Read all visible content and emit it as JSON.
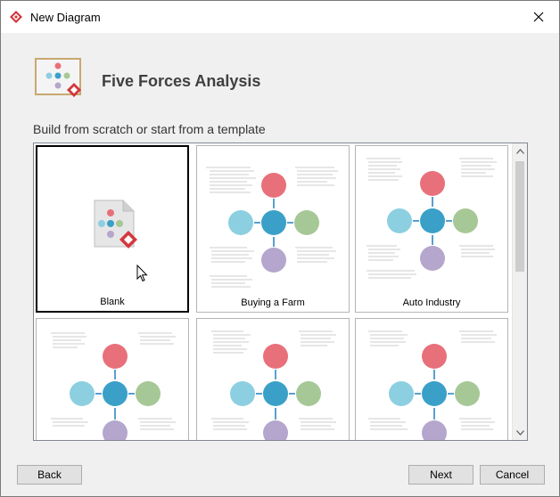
{
  "window": {
    "title": "New Diagram",
    "close_icon": "close-icon"
  },
  "header": {
    "title": "Five Forces Analysis",
    "icon": "five-forces-diagram-icon"
  },
  "subtitle": "Build from scratch or start from a template",
  "templates": [
    {
      "label": "Blank",
      "selected": true
    },
    {
      "label": "Buying a Farm",
      "selected": false
    },
    {
      "label": "Auto Industry",
      "selected": false
    },
    {
      "label": "",
      "selected": false
    },
    {
      "label": "",
      "selected": false
    },
    {
      "label": "",
      "selected": false
    }
  ],
  "footer": {
    "back_label": "Back",
    "next_label": "Next",
    "cancel_label": "Cancel"
  },
  "colors": {
    "red": "#e8707a",
    "blue": "#3aa0c8",
    "lightblue": "#8ccfe0",
    "green": "#a6c896",
    "purple": "#b4a6cc",
    "accent": "#d3373d"
  }
}
